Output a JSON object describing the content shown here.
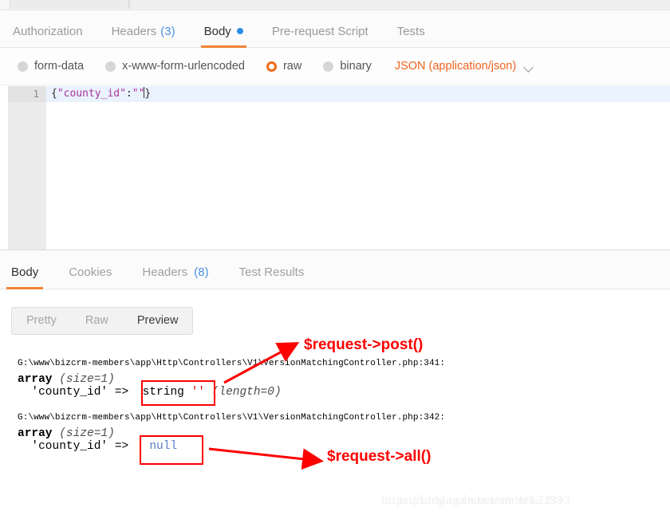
{
  "request_tabs": [
    {
      "label": "Authorization",
      "count": null,
      "active": false,
      "dot": false
    },
    {
      "label": "Headers",
      "count": "(3)",
      "active": false,
      "dot": false
    },
    {
      "label": "Body",
      "count": null,
      "active": true,
      "dot": true
    },
    {
      "label": "Pre-request Script",
      "count": null,
      "active": false,
      "dot": false
    },
    {
      "label": "Tests",
      "count": null,
      "active": false,
      "dot": false
    }
  ],
  "body_types": [
    {
      "label": "form-data",
      "selected": false
    },
    {
      "label": "x-www-form-urlencoded",
      "selected": false
    },
    {
      "label": "raw",
      "selected": true
    },
    {
      "label": "binary",
      "selected": false
    }
  ],
  "mime": {
    "label": "JSON (application/json)",
    "chevron_icon": "chevron-down-icon",
    "color": "#f0641e"
  },
  "editor": {
    "line_number": "1",
    "brace_open": "{",
    "key": "\"county_id\"",
    "colon": ":",
    "value": "\"\"",
    "brace_close": "}"
  },
  "response_tabs": [
    {
      "label": "Body",
      "count": null,
      "active": true
    },
    {
      "label": "Cookies",
      "count": null,
      "active": false
    },
    {
      "label": "Headers",
      "count": "(8)",
      "active": false
    },
    {
      "label": "Test Results",
      "count": null,
      "active": false
    }
  ],
  "view_toggle": [
    {
      "label": "Pretty",
      "active": false
    },
    {
      "label": "Raw",
      "active": false
    },
    {
      "label": "Preview",
      "active": true
    }
  ],
  "dump": {
    "block1": {
      "path": "G:\\www\\bizcrm-members\\app\\Http\\Controllers\\V1\\VersionMatchingController.php:341:",
      "array_label": "array",
      "array_size": "(size=1)",
      "key": "'county_id'",
      "arrow": "=>",
      "value_type": "string",
      "value_quotes": "''",
      "length": "(length=0)"
    },
    "block2": {
      "path": "G:\\www\\bizcrm-members\\app\\Http\\Controllers\\V1\\VersionMatchingController.php:342:",
      "array_label": "array",
      "array_size": "(size=1)",
      "key": "'county_id'",
      "arrow": "=>",
      "value_null": "null"
    }
  },
  "annotations": {
    "post": "$request->post()",
    "all": "$request->all()",
    "color": "#fd0000"
  },
  "watermark": {
    "line1": "https://blog.csdn.net/smile12393",
    "line2": "https://blog.csdn.net/smile12393"
  }
}
